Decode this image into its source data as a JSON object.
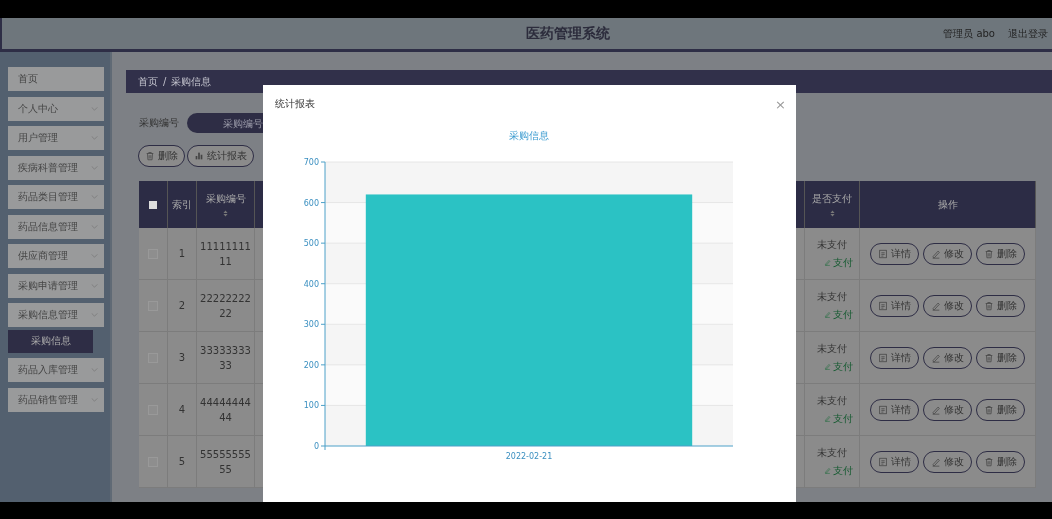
{
  "header": {
    "title": "医药管理系统",
    "user": "管理员 abo",
    "logout": "退出登录"
  },
  "sidebar": {
    "items": [
      {
        "label": "首页",
        "kind": "link"
      },
      {
        "label": "个人中心",
        "kind": "menu"
      },
      {
        "label": "用户管理",
        "kind": "menu"
      },
      {
        "label": "疾病科普管理",
        "kind": "menu"
      },
      {
        "label": "药品类目管理",
        "kind": "menu"
      },
      {
        "label": "药品信息管理",
        "kind": "menu"
      },
      {
        "label": "供应商管理",
        "kind": "menu"
      },
      {
        "label": "采购申请管理",
        "kind": "menu"
      },
      {
        "label": "采购信息管理",
        "kind": "menu",
        "children": [
          {
            "label": "采购信息",
            "selected": true
          }
        ]
      },
      {
        "label": "药品入库管理",
        "kind": "menu"
      },
      {
        "label": "药品销售管理",
        "kind": "menu"
      }
    ]
  },
  "breadcrumb": [
    "首页",
    "/",
    "采购信息"
  ],
  "search": {
    "label": "采购编号",
    "placeholder": "采购编号"
  },
  "toolbar": [
    {
      "label": "删除",
      "kind": "delete"
    },
    {
      "label": "统计报表",
      "kind": "report"
    }
  ],
  "table": {
    "all_checked": false,
    "columns": [
      {
        "label": "索引",
        "sortable": false
      },
      {
        "label": "采购编号",
        "sortable": true
      },
      {
        "label": "是否支付",
        "sortable": true
      },
      {
        "label": "操作",
        "sortable": false
      }
    ],
    "rows": [
      {
        "index": "1",
        "code": "11111111\n11",
        "paid": "未支付",
        "pay": "支付",
        "checked": false,
        "actions": [
          {
            "label": "详情",
            "kind": "details"
          },
          {
            "label": "修改",
            "kind": "edit"
          },
          {
            "label": "删除",
            "kind": "delete"
          }
        ]
      },
      {
        "index": "2",
        "code": "22222222\n22",
        "paid": "未支付",
        "pay": "支付",
        "checked": false,
        "actions": [
          {
            "label": "详情",
            "kind": "details"
          },
          {
            "label": "修改",
            "kind": "edit"
          },
          {
            "label": "删除",
            "kind": "delete"
          }
        ]
      },
      {
        "index": "3",
        "code": "33333333\n33",
        "paid": "未支付",
        "pay": "支付",
        "checked": false,
        "actions": [
          {
            "label": "详情",
            "kind": "details"
          },
          {
            "label": "修改",
            "kind": "edit"
          },
          {
            "label": "删除",
            "kind": "delete"
          }
        ]
      },
      {
        "index": "4",
        "code": "44444444\n44",
        "paid": "未支付",
        "pay": "支付",
        "checked": false,
        "actions": [
          {
            "label": "详情",
            "kind": "details"
          },
          {
            "label": "修改",
            "kind": "edit"
          },
          {
            "label": "删除",
            "kind": "delete"
          }
        ]
      },
      {
        "index": "5",
        "code": "55555555\n55",
        "paid": "未支付",
        "pay": "支付",
        "checked": false,
        "actions": [
          {
            "label": "详情",
            "kind": "details"
          },
          {
            "label": "修改",
            "kind": "edit"
          },
          {
            "label": "删除",
            "kind": "delete"
          }
        ]
      }
    ]
  },
  "dialog": {
    "title": "统计报表",
    "close": "×",
    "chart_data": {
      "type": "bar",
      "title": "采购信息",
      "categories": [
        "2022-02-21"
      ],
      "values": [
        620
      ],
      "grid": true,
      "ylim": [
        0,
        700
      ],
      "yticks": [
        0,
        100,
        200,
        300,
        400,
        500,
        600,
        700
      ]
    }
  }
}
